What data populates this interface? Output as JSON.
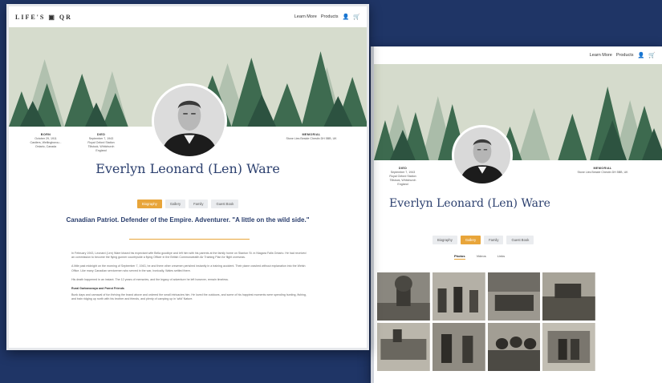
{
  "front": {
    "logo": "LIFE'S ▣ QR",
    "nav": {
      "learn_more": "Learn More",
      "products": "Products"
    },
    "name": "Everlyn Leonard (Len) Ware",
    "born": {
      "label": "BORN",
      "lines": [
        "October 29, 1911",
        "Castlers, Wellingborou...",
        "Ontario, Canada"
      ]
    },
    "died": {
      "label": "DIED",
      "lines": [
        "September 7, 1943",
        "Royal Oxford Station",
        "Tillstock, Whitchurch",
        "England"
      ]
    },
    "memorial": {
      "label": "MEMORIAL",
      "lines": [
        "Stone Lies Beside Chestin DH 5BB, UK"
      ]
    },
    "tabs": [
      "Biography",
      "Gallery",
      "Family",
      "Guest Book"
    ],
    "motto": "Canadian Patriot. Defender of the Empire. Adventurer. \"A little on the wild side.\"",
    "paragraphs": [
      "In February 1943, Leonard (Len) Ware kissed his expectant wife Bella goodbye and left him with his parents at the family home on Stanton St. in Niagara Falls Ontario. He had received an commission to become the flying gunner countryside a flying Officer in the British Commonwealth Air Training Plan for flight overseas.",
      "A little past midnight on the morning of September 7, 1943, he and three other crewmen perished instantly in a training accident. Their plane crashed without explanation into the Welsh Office. Like many Canadian servicemen who served in the war, Ironically, Wales settled there.",
      "His death happened in an instant. The 12 years of memories, and the legacy of adventure he left however, remain timeless."
    ],
    "section_heading": "Rural Garbanovaya and Parrot Friends",
    "section_text": "Bunk days and carnaval of fun thriving the brand above and ordered the small intricacies him. He loved the outdoors, and some of his happiest moments were spending hunting, fishing, and train ridging up north with his brother and friends, and plenty of camping up in 'wild' Nature."
  },
  "back": {
    "nav": {
      "learn_more": "Learn More",
      "products": "Products"
    },
    "name": "Everlyn Leonard (Len) Ware",
    "died": {
      "label": "DIED",
      "lines": [
        "September 7, 1943",
        "Royal Oxford Station",
        "Tillstock, Whitchurch",
        "England"
      ]
    },
    "memorial": {
      "label": "MEMORIAL",
      "lines": [
        "Stone Lies Beside Chestin DH 5BB, UK"
      ]
    },
    "tabs": [
      "Biography",
      "Gallery",
      "Family",
      "Guest Book"
    ],
    "subtabs": [
      "Photos",
      "Videos",
      "Links"
    ]
  },
  "colors": {
    "navy": "#1f3566",
    "accent": "#e8a53a",
    "heading": "#2b3f6e"
  },
  "icons": [
    "user-icon",
    "cart-icon"
  ]
}
